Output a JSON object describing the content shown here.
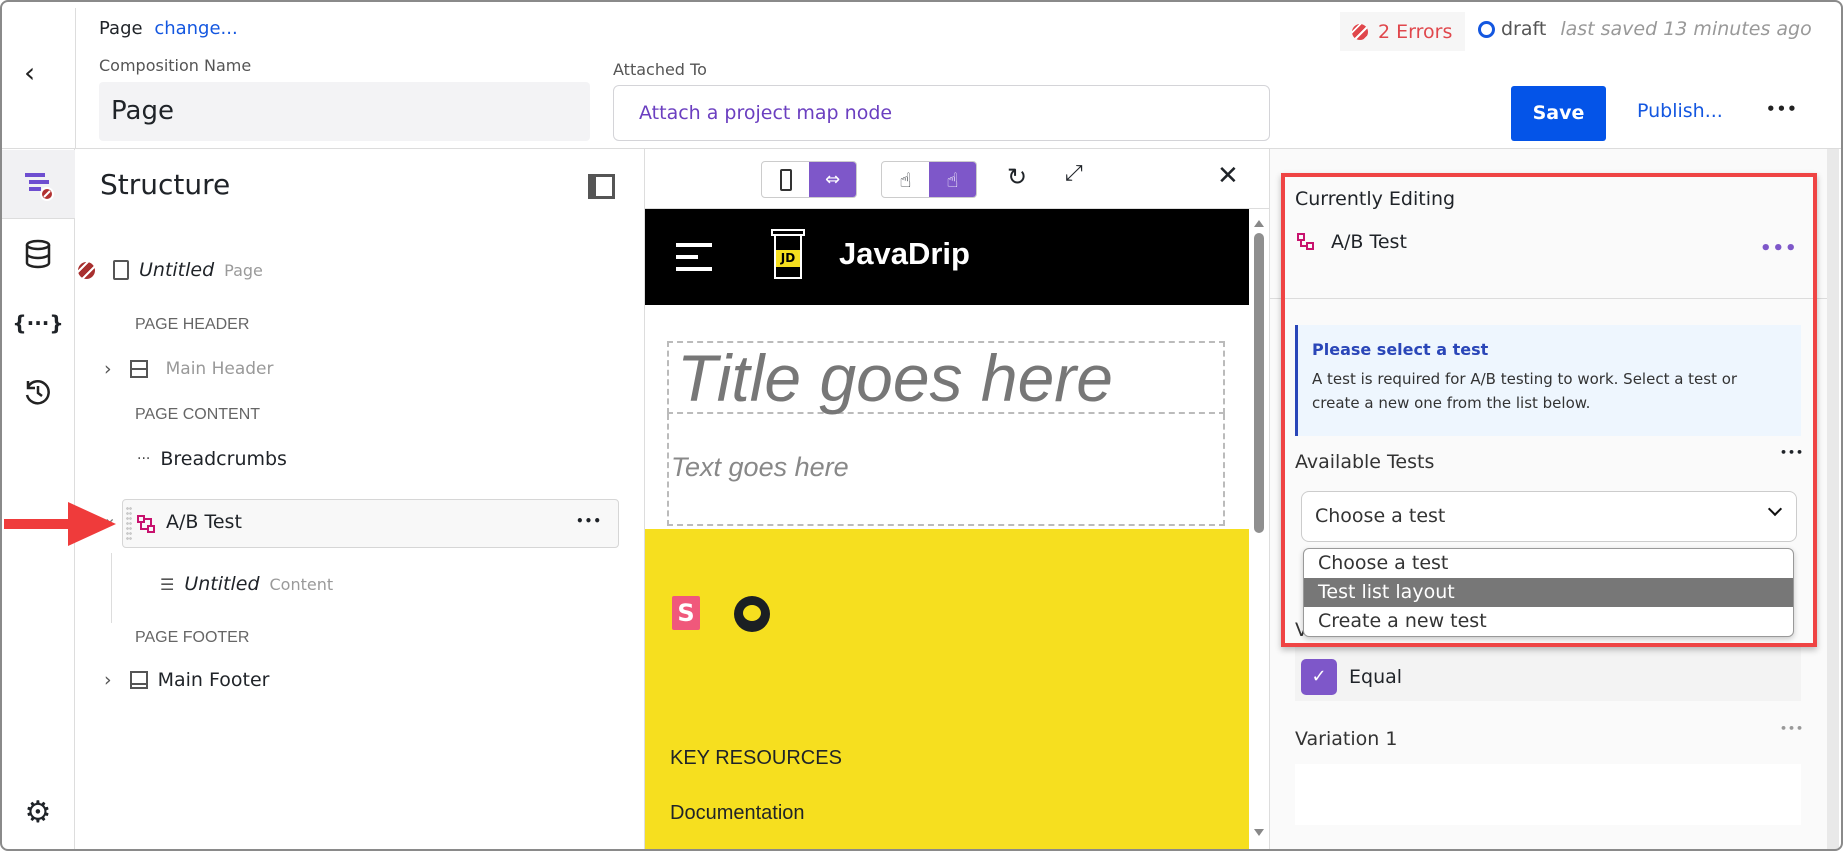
{
  "header": {
    "type_label": "Page",
    "change_link": "change...",
    "composition_name_label": "Composition Name",
    "composition_name_value": "Page",
    "attached_to_label": "Attached To",
    "attach_placeholder": "Attach a project map node",
    "errors": "2 Errors",
    "status": "draft",
    "last_saved": "last saved 13 minutes ago",
    "save": "Save",
    "publish": "Publish...",
    "more": "•••"
  },
  "rail": {
    "items": [
      "structure-icon",
      "database-icon",
      "variables-icon",
      "history-icon",
      "settings-icon"
    ]
  },
  "structure": {
    "title": "Structure",
    "root": {
      "name": "Untitled",
      "type": "Page"
    },
    "sections": [
      {
        "label": "PAGE HEADER",
        "items": [
          {
            "name": "Main Header"
          }
        ]
      },
      {
        "label": "PAGE CONTENT",
        "items": [
          {
            "name": "Breadcrumbs"
          },
          {
            "name": "A/B Test",
            "children": [
              {
                "name": "Untitled",
                "type": "Content"
              }
            ]
          }
        ]
      },
      {
        "label": "PAGE FOOTER",
        "items": [
          {
            "name": "Main Footer"
          }
        ]
      }
    ],
    "item_more": "•••"
  },
  "canvas": {
    "brand": "JavaDrip",
    "logo_text": "JD",
    "title_placeholder": "Title goes here",
    "text_placeholder": "Text goes here",
    "key_resources": "KEY RESOURCES",
    "documentation": "Documentation",
    "colors": {
      "header": "#000000",
      "footer": "#f6df1f",
      "accent": "#7e57c9"
    }
  },
  "properties": {
    "currently_editing": "Currently Editing",
    "component": "A/B Test",
    "info_title": "Please select a test",
    "info_body": "A test is required for A/B testing to work. Select a test or create a new one from the list below.",
    "available_tests_label": "Available Tests",
    "select_value": "Choose a test",
    "options": [
      "Choose a test",
      "Test list layout",
      "Create a new test"
    ],
    "highlighted_option": "Test list layout",
    "visitor_distribution_label": "Visitor Distribution",
    "equal_label": "Equal",
    "equal_checked": true,
    "variation_label": "Variation 1",
    "more": "•••"
  }
}
